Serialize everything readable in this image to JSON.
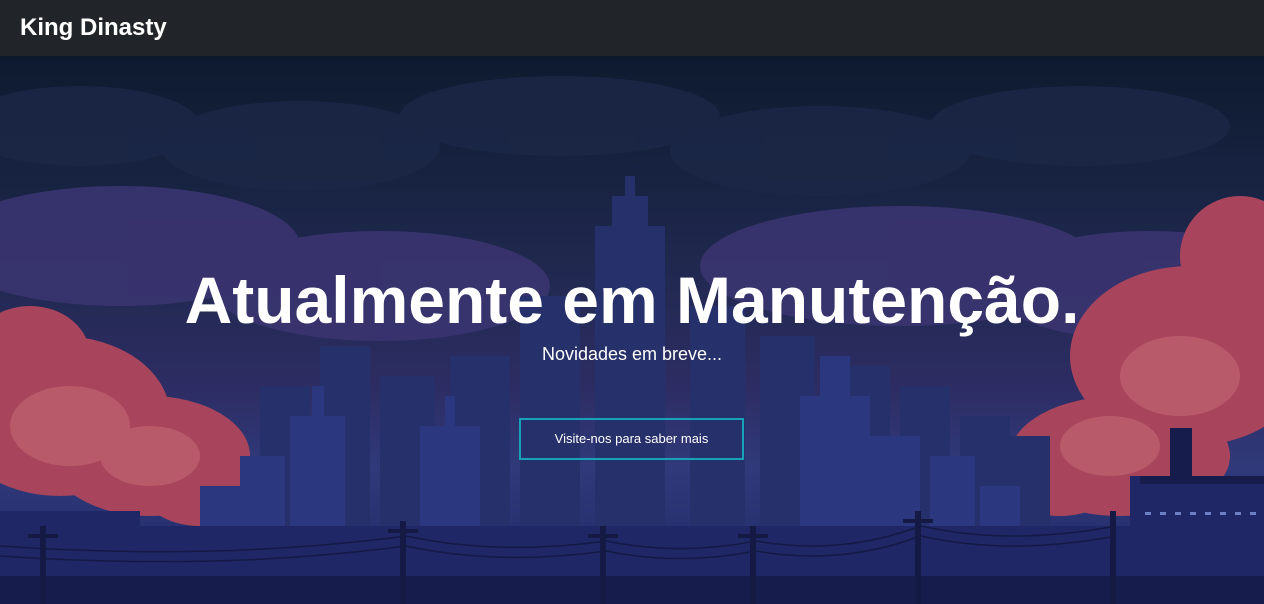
{
  "navbar": {
    "brand": "King Dinasty"
  },
  "hero": {
    "headline": "Atualmente em Manutenção.",
    "subline": "Novidades em breve...",
    "cta_label": "Visite-nos para saber mais"
  },
  "colors": {
    "navbar_bg": "#212529",
    "cta_border": "#17a2b8",
    "text": "#ffffff",
    "sky_top": "#0d1a2e",
    "clouds_red": "#b04a5e"
  }
}
